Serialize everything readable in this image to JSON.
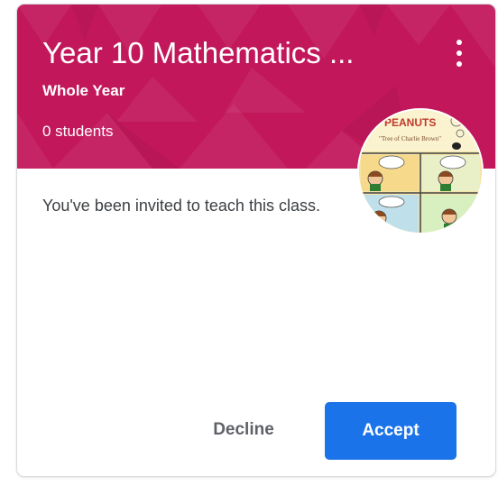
{
  "class_card": {
    "title": "Year 10 Mathematics ...",
    "section": "Whole Year",
    "student_count": "0 students",
    "header_color": "#c2185b",
    "menu_icon": "more-vertical-icon",
    "avatar": "class-owner-avatar-comic",
    "avatar_comic_text": {
      "banner": "PEANUTS",
      "caption": "\"Tree of Charlie Brown\""
    },
    "invite_message": "You've been invited to teach this class.",
    "actions": {
      "decline_label": "Decline",
      "accept_label": "Accept",
      "accept_color": "#1a73e8"
    }
  }
}
